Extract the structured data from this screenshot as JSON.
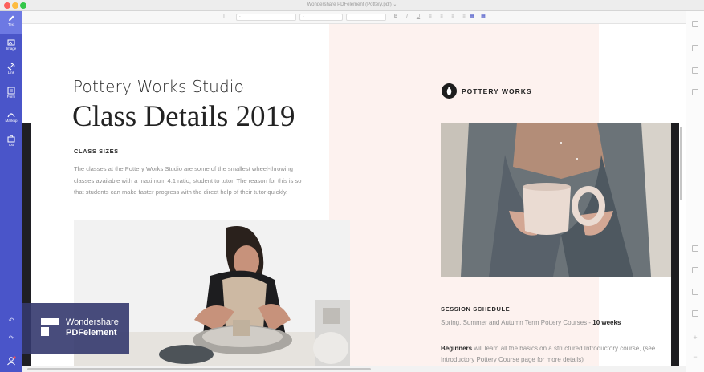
{
  "window": {
    "title": "Wondershare PDFelement  (Pottery.pdf)  ⌄"
  },
  "sidebar": {
    "tools": [
      {
        "label": "Text",
        "icon": "pen-icon",
        "active": true
      },
      {
        "label": "Image",
        "icon": "image-icon",
        "active": false
      },
      {
        "label": "Link",
        "icon": "link-icon",
        "active": false
      },
      {
        "label": "Form",
        "icon": "form-icon",
        "active": false
      },
      {
        "label": "Markup",
        "icon": "markup-icon",
        "active": false
      },
      {
        "label": "Tool",
        "icon": "toolbox-icon",
        "active": false
      }
    ],
    "undo_symbol": "↶",
    "redo_symbol": "↷"
  },
  "toolbar": {
    "font_placeholder": "-",
    "size_placeholder": "-",
    "buttons": [
      "B",
      "I",
      "U"
    ]
  },
  "document": {
    "subtitle": "Pottery Works Studio",
    "title": "Class Details 2019",
    "class_sizes_heading": "CLASS SIZES",
    "class_sizes_text": "The classes at the Pottery Works Studio are some of the smallest wheel-throwing classes available with a maximum 4:1 ratio, student to tutor. The reason for this is so that students can make faster progress with the direct help of their tutor quickly.",
    "logo_text": "POTTERY WORKS",
    "session_heading": "SESSION SCHEDULE",
    "session_line1_prefix": "Spring, Summer and Autumn Term Pottery Courses - ",
    "session_line1_bold": "10 weeks",
    "beginners_bold": "Beginners",
    "beginners_text": " will learn all the basics on a structured Introductory course, (see Introductory Pottery Course page for more details)"
  },
  "badge": {
    "line1": "Wondershare",
    "line2": "PDFelement"
  },
  "colors": {
    "sidebar": "#4a55c9",
    "accent_panel": "#fdf2ef",
    "badge": "#34396e"
  }
}
